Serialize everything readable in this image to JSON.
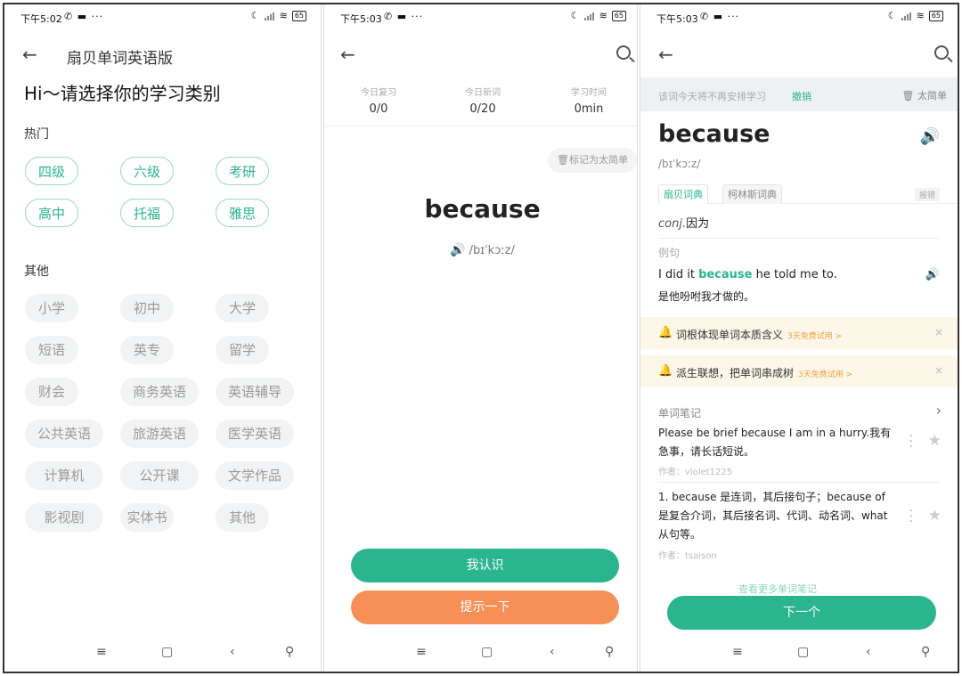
{
  "status": {
    "s1_time": "下午5:02",
    "s2_time": "下午5:03",
    "s3_time": "下午5:03",
    "battery": "65"
  },
  "screen1": {
    "title": "扇贝单词英语版",
    "heading": "Hi～请选择你的学习类别",
    "hot_label": "热门",
    "hot": [
      "四级",
      "六级",
      "考研",
      "高中",
      "托福",
      "雅思"
    ],
    "other_label": "其他",
    "other": [
      "小学",
      "初中",
      "大学",
      "短语",
      "英专",
      "留学",
      "财会",
      "商务英语",
      "英语辅导",
      "公共英语",
      "旅游英语",
      "医学英语",
      "计算机",
      "公开课",
      "文学作品",
      "影视剧",
      "实体书",
      "其他"
    ]
  },
  "screen2": {
    "stats": [
      {
        "label": "今日复习",
        "value": "0/0"
      },
      {
        "label": "今日新词",
        "value": "0/20"
      },
      {
        "label": "学习时间",
        "value": "0min"
      }
    ],
    "mark_easy": "标记为太简单",
    "word": "because",
    "phonetic": "/bɪˈkɔːz/",
    "know_button": "我认识",
    "hint_button": "提示一下"
  },
  "screen3": {
    "banner_text": "该词今天将不再安排学习",
    "banner_undo": "撤销",
    "banner_easy": "太简单",
    "word": "because",
    "phonetic": "/bɪˈkɔːz/",
    "tab1": "扇贝词典",
    "tab2": "柯林斯词典",
    "fold": "报错",
    "pos": "conj.",
    "definition": "因为",
    "example_label": "例句",
    "example_pre": "I did it ",
    "example_word": "because",
    "example_post": " he told me to.",
    "example_zh": "是他吩咐我才做的。",
    "promo1_text": "词根体现单词本质含义",
    "promo1_trial": "3天免费试用 >",
    "promo2_text": "派生联想，把单词串成树",
    "promo2_trial": "3天免费试用 >",
    "notes_label": "单词笔记",
    "note1_text": "Please be brief because I am in a hurry.我有急事，请长话短说。",
    "note1_author": "作者：violet1225",
    "note2_text": "1. because 是连词，其后接句子；because of 是复合介词，其后接名词、代词、动名词、what 从句等。",
    "note2_author": "作者：tsaison",
    "faded_text": "查看更多单词笔记",
    "next_button": "下一个"
  }
}
